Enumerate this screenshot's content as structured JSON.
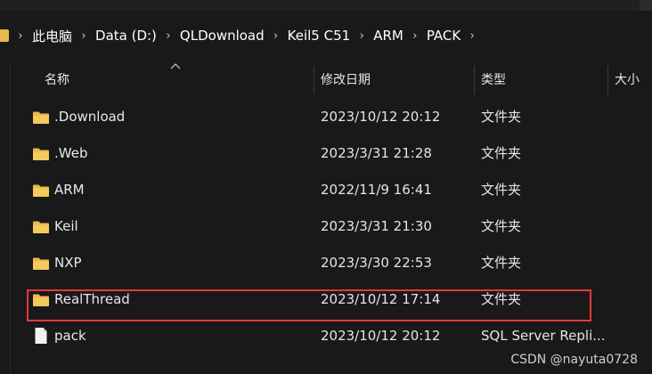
{
  "breadcrumb": {
    "items": [
      "此电脑",
      "Data (D:)",
      "QLDownload",
      "Keil5 C51",
      "ARM",
      "PACK"
    ],
    "separator": "›"
  },
  "columns": {
    "name": "名称",
    "date": "修改日期",
    "type": "类型",
    "size": "大小"
  },
  "rows": [
    {
      "name": ".Download",
      "date": "2023/10/12 20:12",
      "type": "文件夹",
      "kind": "folder"
    },
    {
      "name": ".Web",
      "date": "2023/3/31 21:28",
      "type": "文件夹",
      "kind": "folder"
    },
    {
      "name": "ARM",
      "date": "2022/11/9 16:41",
      "type": "文件夹",
      "kind": "folder"
    },
    {
      "name": "Keil",
      "date": "2023/3/31 21:30",
      "type": "文件夹",
      "kind": "folder"
    },
    {
      "name": "NXP",
      "date": "2023/3/30 22:53",
      "type": "文件夹",
      "kind": "folder"
    },
    {
      "name": "RealThread",
      "date": "2023/10/12 17:14",
      "type": "文件夹",
      "kind": "folder"
    },
    {
      "name": "pack",
      "date": "2023/10/12 20:12",
      "type": "SQL Server Repli...",
      "kind": "file"
    }
  ],
  "highlighted_row": "RealThread",
  "watermark": "CSDN @nayuta0728",
  "colors": {
    "background": "#191919",
    "folder": "#e9b949",
    "highlight": "#e53935",
    "text": "#e8e8e8"
  },
  "icons": {
    "folder": "folder-icon",
    "file": "file-icon",
    "sort": "sort-up-icon"
  }
}
